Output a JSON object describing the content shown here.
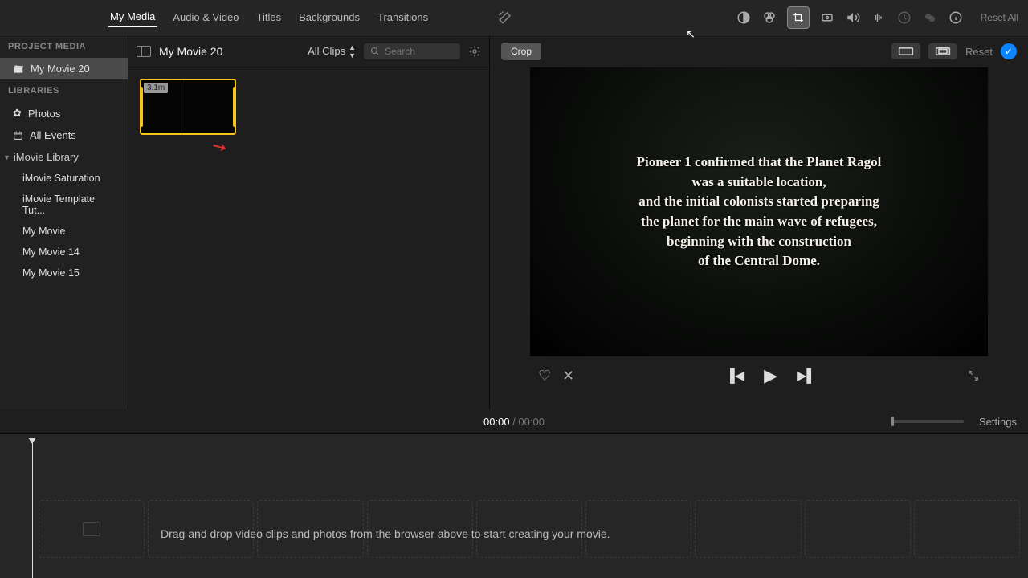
{
  "tabs": {
    "my_media": "My Media",
    "audio_video": "Audio & Video",
    "titles": "Titles",
    "backgrounds": "Backgrounds",
    "transitions": "Transitions"
  },
  "reset_all": "Reset All",
  "sidebar": {
    "project_media_header": "PROJECT MEDIA",
    "project_name": "My Movie 20",
    "libraries_header": "LIBRARIES",
    "photos": "Photos",
    "all_events": "All Events",
    "imovie_library": "iMovie Library",
    "items": [
      "iMovie Saturation",
      "iMovie Template Tut...",
      "My Movie",
      "My Movie 14",
      "My Movie 15"
    ]
  },
  "browser": {
    "title": "My Movie 20",
    "clips_filter": "All Clips",
    "search_placeholder": "Search",
    "clip_duration": "3.1m"
  },
  "viewer": {
    "mode_label": "Crop",
    "reset": "Reset",
    "video_text": "Pioneer 1 confirmed that the Planet Ragol\nwas a suitable location,\nand the initial colonists started preparing\nthe planet for the main wave of refugees,\nbeginning with the construction\nof the Central Dome."
  },
  "time": {
    "current": "00:00",
    "sep": " / ",
    "duration": "00:00",
    "settings": "Settings"
  },
  "timeline": {
    "hint": "Drag and drop video clips and photos from the browser above to start creating your movie."
  }
}
